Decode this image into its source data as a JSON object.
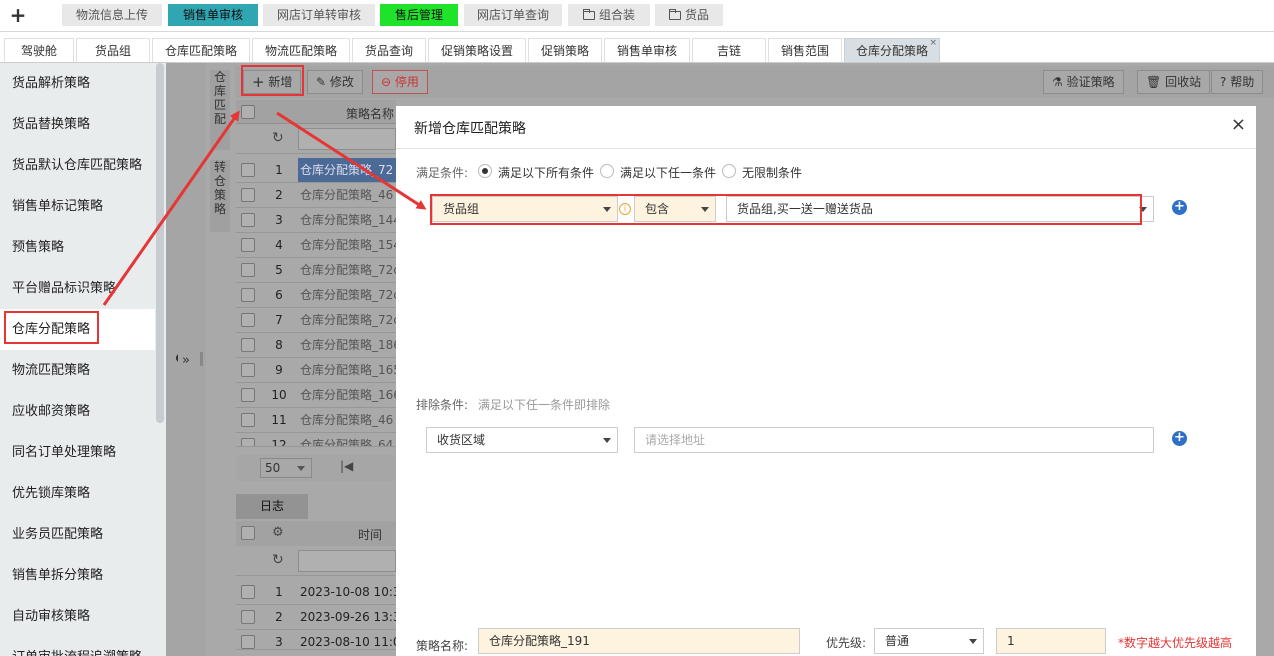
{
  "topbar": {
    "plus": "+",
    "tabs": [
      "物流信息上传",
      "销售单审核",
      "网店订单转审核",
      "售后管理",
      "网店订单查询",
      "组合装",
      "货品"
    ]
  },
  "tabs2": [
    "驾驶舱",
    "货品组",
    "仓库匹配策略",
    "物流匹配策略",
    "货品查询",
    "促销策略设置",
    "促销策略",
    "销售单审核",
    "吉链",
    "销售范围",
    "仓库分配策略"
  ],
  "tab_close": "×",
  "sidebar": [
    "货品解析策略",
    "货品替换策略",
    "货品默认仓库匹配策略",
    "销售单标记策略",
    "预售策略",
    "平台赠品标识策略",
    "仓库分配策略",
    "物流匹配策略",
    "应收邮资策略",
    "同名订单处理策略",
    "优先锁库策略",
    "业务员匹配策略",
    "销售单拆分策略",
    "自动审核策略",
    "订单审批流程追溯策略"
  ],
  "vertical_labels": {
    "a": "仓库匹配",
    "b": "转仓策略"
  },
  "toolbar": {
    "add": "新增",
    "edit": "修改",
    "disable": "停用",
    "verify": "验证策略",
    "recycle": "回收站",
    "help": "帮助"
  },
  "grid": {
    "header": "策略名称",
    "rows": [
      {
        "n": "1",
        "name": "仓库分配策略_72"
      },
      {
        "n": "2",
        "name": "仓库分配策略_46"
      },
      {
        "n": "3",
        "name": "仓库分配策略_144"
      },
      {
        "n": "4",
        "name": "仓库分配策略_154"
      },
      {
        "n": "5",
        "name": "仓库分配策略_72c"
      },
      {
        "n": "6",
        "name": "仓库分配策略_72c"
      },
      {
        "n": "7",
        "name": "仓库分配策略_72c"
      },
      {
        "n": "8",
        "name": "仓库分配策略_186"
      },
      {
        "n": "9",
        "name": "仓库分配策略_165"
      },
      {
        "n": "10",
        "name": "仓库分配策略_166"
      },
      {
        "n": "11",
        "name": "仓库分配策略_46"
      },
      {
        "n": "12",
        "name": "仓库分配策略_64"
      }
    ],
    "page_size": "50"
  },
  "log": {
    "tab": "日志",
    "header": "时间",
    "rows": [
      {
        "n": "1",
        "t": "2023-10-08 10:3"
      },
      {
        "n": "2",
        "t": "2023-09-26 13:3"
      },
      {
        "n": "3",
        "t": "2023-08-10 11:0"
      }
    ]
  },
  "modal": {
    "title": "新增仓库匹配策略",
    "close": "×",
    "cond_label": "满足条件:",
    "radios": [
      "满足以下所有条件",
      "满足以下任一条件",
      "无限制条件"
    ],
    "cond_field": "货品组",
    "cond_op": "包含",
    "cond_value": "货品组,买一送一赠送货品",
    "exclude_label": "排除条件:",
    "exclude_hint": "满足以下任一条件即排除",
    "exclude_field": "收货区域",
    "exclude_placeholder": "请选择地址",
    "name_label": "策略名称:",
    "name_value": "仓库分配策略_191",
    "priority_label": "优先级:",
    "priority_value": "普通",
    "priority_num": "1",
    "priority_hint": "*数字越大优先级越高"
  },
  "colors": {
    "teal": "#31a6b3",
    "green": "#1fe32a",
    "red": "#e53535",
    "blue": "#2f6fc7"
  }
}
